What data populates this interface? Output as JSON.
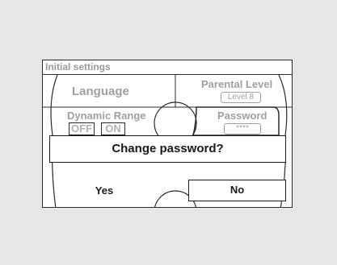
{
  "screen": {
    "title": "Initial settings",
    "menu": {
      "language": "Language",
      "parental_level": "Parental Level",
      "parental_level_value": "Level 8",
      "dynamic_range": "Dynamic Range",
      "dynamic_range_off": "OFF",
      "dynamic_range_on": "ON",
      "password": "Password",
      "password_value": "****"
    },
    "dialog": {
      "message": "Change password?",
      "yes_label": "Yes",
      "no_label": "No"
    }
  },
  "colors": {
    "background": "#e6e6e6",
    "screen": "#ffffff",
    "border": "#2a2a2a",
    "muted_text": "#a0a0a0",
    "text": "#1a1a1a"
  }
}
